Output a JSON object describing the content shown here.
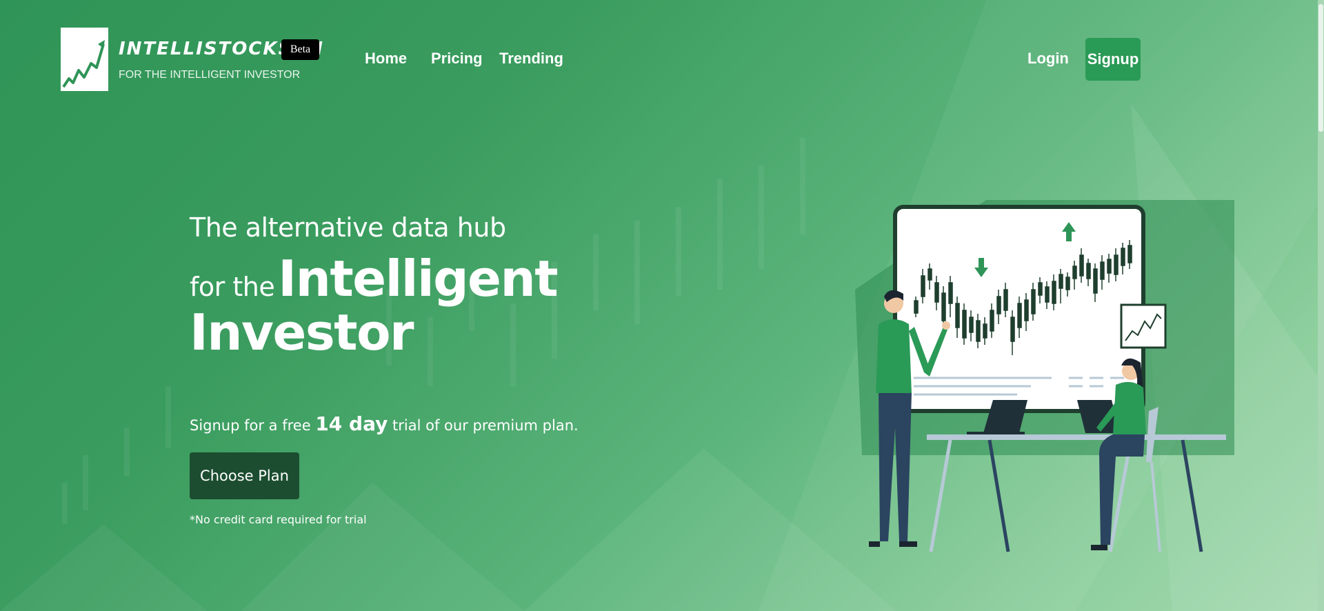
{
  "brand": {
    "name": "INTELLISTOCKS.AI",
    "tagline": "FOR THE INTELLIGENT INVESTOR",
    "badge": "Beta"
  },
  "nav": {
    "items": [
      {
        "label": "Home"
      },
      {
        "label": "Pricing"
      },
      {
        "label": "Trending"
      }
    ],
    "login_label": "Login",
    "signup_label": "Signup"
  },
  "hero": {
    "line1": "The alternative data hub",
    "line2_prefix": "for the",
    "line2_highlight": "Intelligent",
    "line3": "Investor",
    "trial_prefix": "Signup for a free",
    "trial_highlight": "14 day",
    "trial_suffix": "trial of our premium plan.",
    "cta_label": "Choose Plan",
    "note": "*No credit card required for trial"
  },
  "illustration": {
    "icons": [
      "trending-up-icon",
      "arrow-up-icon",
      "arrow-down-icon"
    ]
  },
  "colors": {
    "accent": "#2a9a57",
    "cta": "#1c4d30",
    "background_start": "#2f9457",
    "background_end": "#a5d9b0"
  }
}
